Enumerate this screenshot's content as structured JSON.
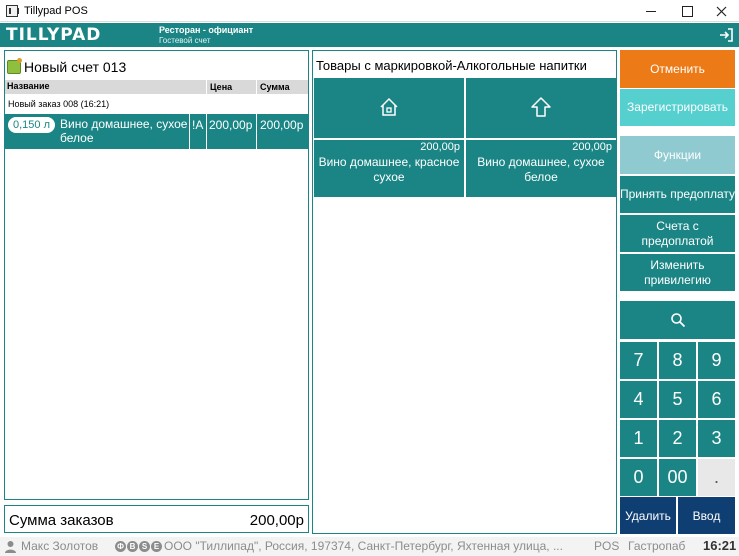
{
  "window": {
    "title": "Tillypad POS"
  },
  "header": {
    "logo": "TILLYPAD",
    "context_line1": "Ресторан - официант",
    "context_line2": "Гостевой счет"
  },
  "check": {
    "title": "Новый счет 013",
    "columns": {
      "name": "Название",
      "price": "Цена",
      "sum": "Сумма"
    },
    "order_label": "Новый заказ 008 (16:21)",
    "item": {
      "qty": "0,150 л",
      "name": "Вино домашнее, сухое белое",
      "flag": "!A",
      "price": "200,00р",
      "sum": "200,00р"
    },
    "total_label": "Сумма заказов",
    "total_value": "200,00р"
  },
  "catalog": {
    "title": "Товары с маркировкой-Алкогольные напитки",
    "nav": [
      {
        "icon": "home-icon"
      },
      {
        "icon": "up-arrow-icon"
      }
    ],
    "products": [
      {
        "price": "200,00р",
        "name": "Вино домашнее, красное сухое"
      },
      {
        "price": "200,00р",
        "name": "Вино домашнее, сухое белое"
      }
    ]
  },
  "actions": {
    "cancel": "Отменить",
    "register": "Зарегистрировать",
    "functions": "Функции",
    "prepay": "Принять предоплату",
    "prepaid_checks": "Счета с предоплатой",
    "change_privilege": "Изменить привилегию",
    "search_icon": "search-icon"
  },
  "keypad": {
    "keys": [
      "7",
      "8",
      "9",
      "4",
      "5",
      "6",
      "1",
      "2",
      "3",
      "0",
      "00",
      "."
    ],
    "delete": "Удалить",
    "enter": "Ввод"
  },
  "status": {
    "user": "Макс Золотов",
    "circles": [
      "Ф",
      "В",
      "S",
      "Е"
    ],
    "address": "ООО \"Тиллипад\", Россия, 197374, Санкт-Петербург, Яхтенная улица, ...",
    "mode": "POS",
    "restaurant": "Гастропаб",
    "time": "16:21"
  },
  "colors": {
    "teal": "#1b8585",
    "orange": "#ec7a16",
    "light_teal": "#56cfcf",
    "pale_teal": "#8fcad0",
    "navy": "#0f3f72"
  }
}
